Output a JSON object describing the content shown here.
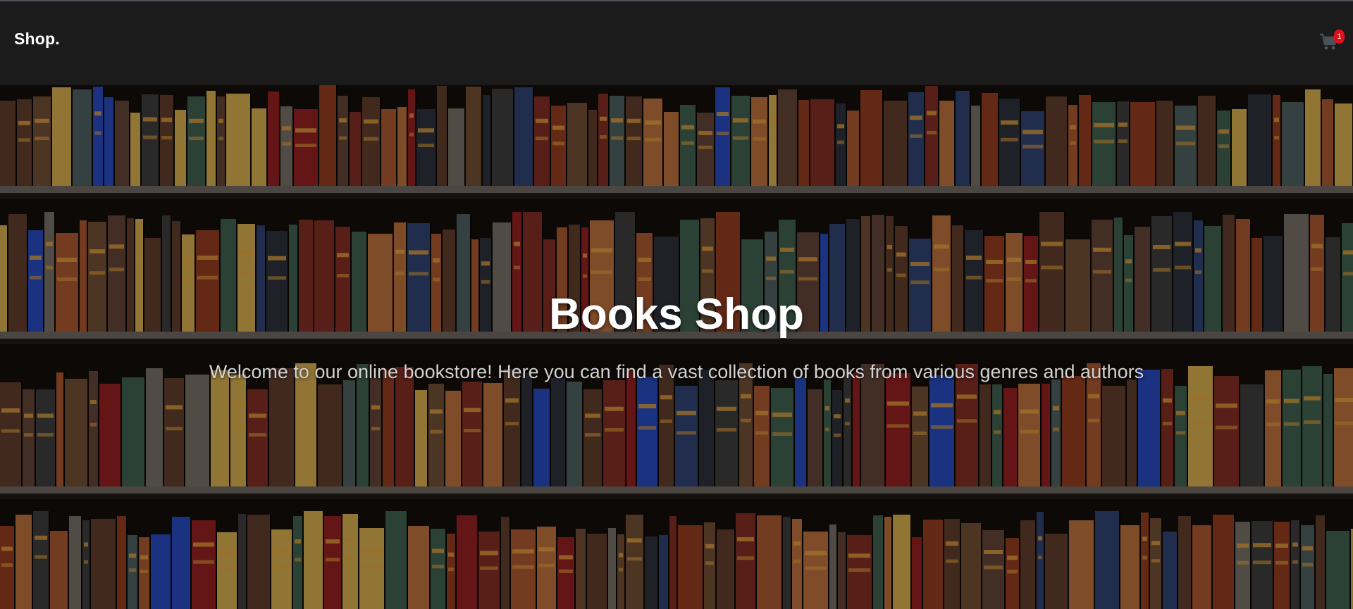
{
  "navbar": {
    "brand": "Shop.",
    "cart": {
      "icon": "cart-icon",
      "count": "1"
    }
  },
  "hero": {
    "title": "Books Shop",
    "subtitle": "Welcome to our online bookstore! Here you can find a vast collection of books from various genres and authors",
    "background": "bookshelf-image"
  },
  "colors": {
    "navbar_bg": "#1b1b1b",
    "badge": "#e0101b",
    "title": "#ffffff",
    "subtitle": "#d2d2d2"
  }
}
